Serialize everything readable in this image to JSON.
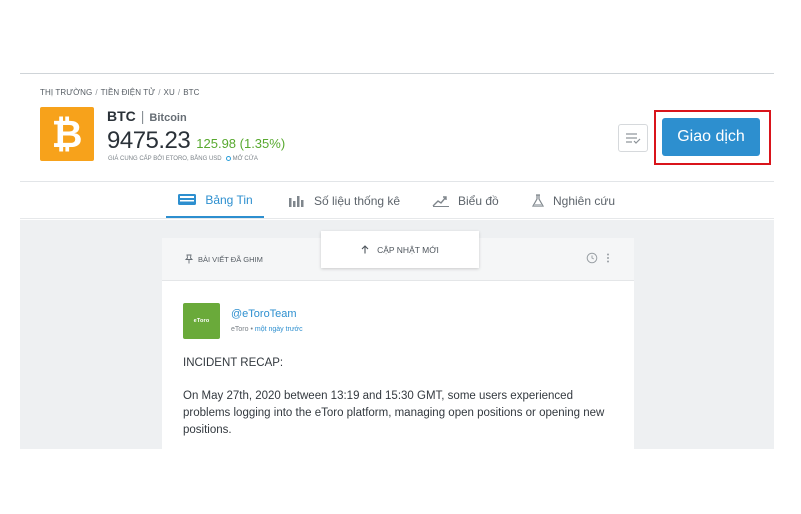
{
  "breadcrumb": [
    "THỊ TRƯỜNG",
    "TIỀN ĐIỆN TỬ",
    "XU",
    "BTC"
  ],
  "asset": {
    "logo_glyph": "₿",
    "symbol": "BTC",
    "name": "Bitcoin",
    "price": "9475.23",
    "change": "125.98 (1.35%)",
    "price_note": "GIÁ CUNG CẤP BỞI ETORO, BẰNG USD",
    "status": "MỞ CỬA"
  },
  "actions": {
    "trade_label": "Giao dịch",
    "watchlist_icon": "watchlist-icon"
  },
  "tabs": [
    {
      "label": "Bảng Tin",
      "icon": "news-feed-icon",
      "active": true
    },
    {
      "label": "Số liệu thống kê",
      "icon": "stats-icon",
      "active": false
    },
    {
      "label": "Biểu đồ",
      "icon": "chart-icon",
      "active": false
    },
    {
      "label": "Nghiên cứu",
      "icon": "research-flask-icon",
      "active": false
    }
  ],
  "feed": {
    "pinned_label": "BÀI VIẾT ĐÃ GHIM",
    "update_label": "CẬP NHẬT MỚI",
    "post": {
      "avatar_text": "eToro",
      "author": "@eToroTeam",
      "source": "eToro",
      "time": "một ngày trước",
      "paragraphs": [
        "INCIDENT RECAP:",
        "On May 27th, 2020 between 13:19 and 15:30 GMT, some users experienced problems logging into the eToro platform, managing open positions or opening new positions."
      ]
    }
  },
  "colors": {
    "accent": "#2d8fcf",
    "bitcoin": "#f7a21b",
    "positive": "#58a92f",
    "highlight": "#d9141b"
  }
}
